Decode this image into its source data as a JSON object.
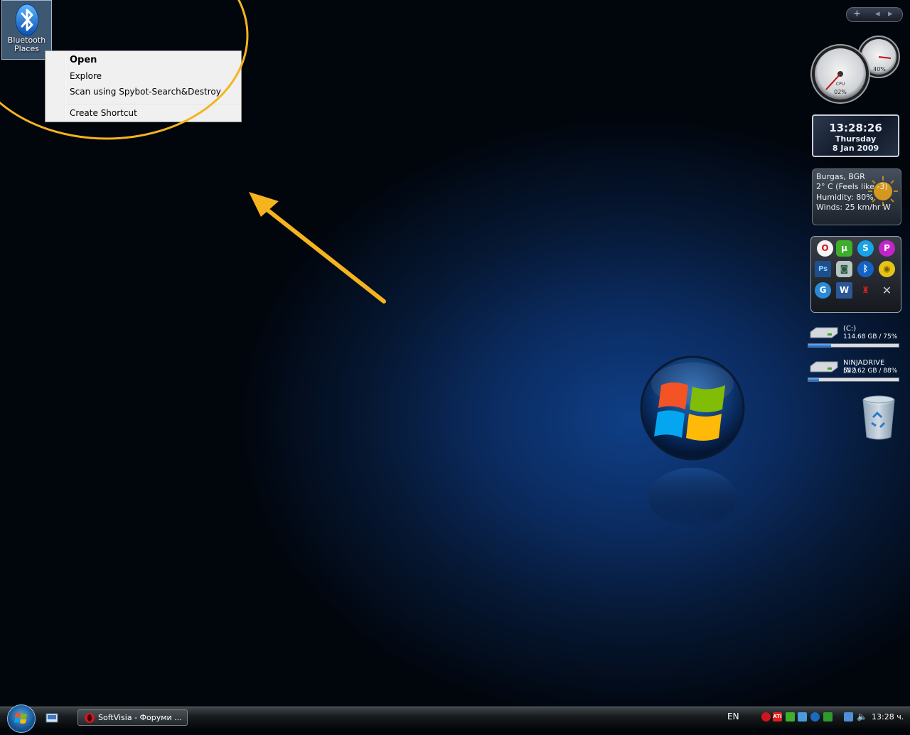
{
  "desktop": {
    "icons": [
      {
        "label_line1": "Bluetooth",
        "label_line2": "Places"
      }
    ]
  },
  "context_menu": {
    "items": [
      {
        "label": "Open",
        "bold": true
      },
      {
        "label": "Explore"
      },
      {
        "label": "Scan using Spybot-Search&Destroy"
      },
      {
        "label": "Create Shortcut"
      }
    ]
  },
  "gadget_controls": {
    "add_label": "+",
    "prev_label": "◂",
    "next_label": "▸"
  },
  "cpu_meter": {
    "cpu_label": "CPU",
    "cpu_percent": "02%",
    "mem_percent": "40%",
    "cpu_value": 0.02,
    "mem_value": 0.4
  },
  "clock": {
    "time": "13:28:26",
    "day": "Thursday",
    "date": "8 Jan 2009"
  },
  "weather": {
    "location": "Burgas, BGR",
    "temperature": "2° C (Feels like -3)",
    "humidity": "Humidity: 80%",
    "winds": "Winds: 25 km/hr W"
  },
  "launcher": {
    "icons": [
      "opera-icon",
      "utorrent-icon",
      "skype-icon",
      "picasa-icon",
      "photoshop-icon",
      "shell-icon",
      "bluetooth-icon",
      "disc-icon",
      "browser-icon",
      "word-icon",
      "joystick-icon",
      "crossed-swords-icon"
    ]
  },
  "drives": [
    {
      "name": "(C:)",
      "stats": "114.68 GB / 75%",
      "used": 0.25
    },
    {
      "name": "NINJADRIVE (N:)",
      "stats": "522.62 GB / 88%",
      "used": 0.12
    }
  ],
  "taskbar": {
    "task_label": "SoftVisia - Форуми ...",
    "language": "EN",
    "clock": "13:28 ч."
  },
  "colors": {
    "annotation": "#f5b41e",
    "accent": "#1c66c8"
  }
}
